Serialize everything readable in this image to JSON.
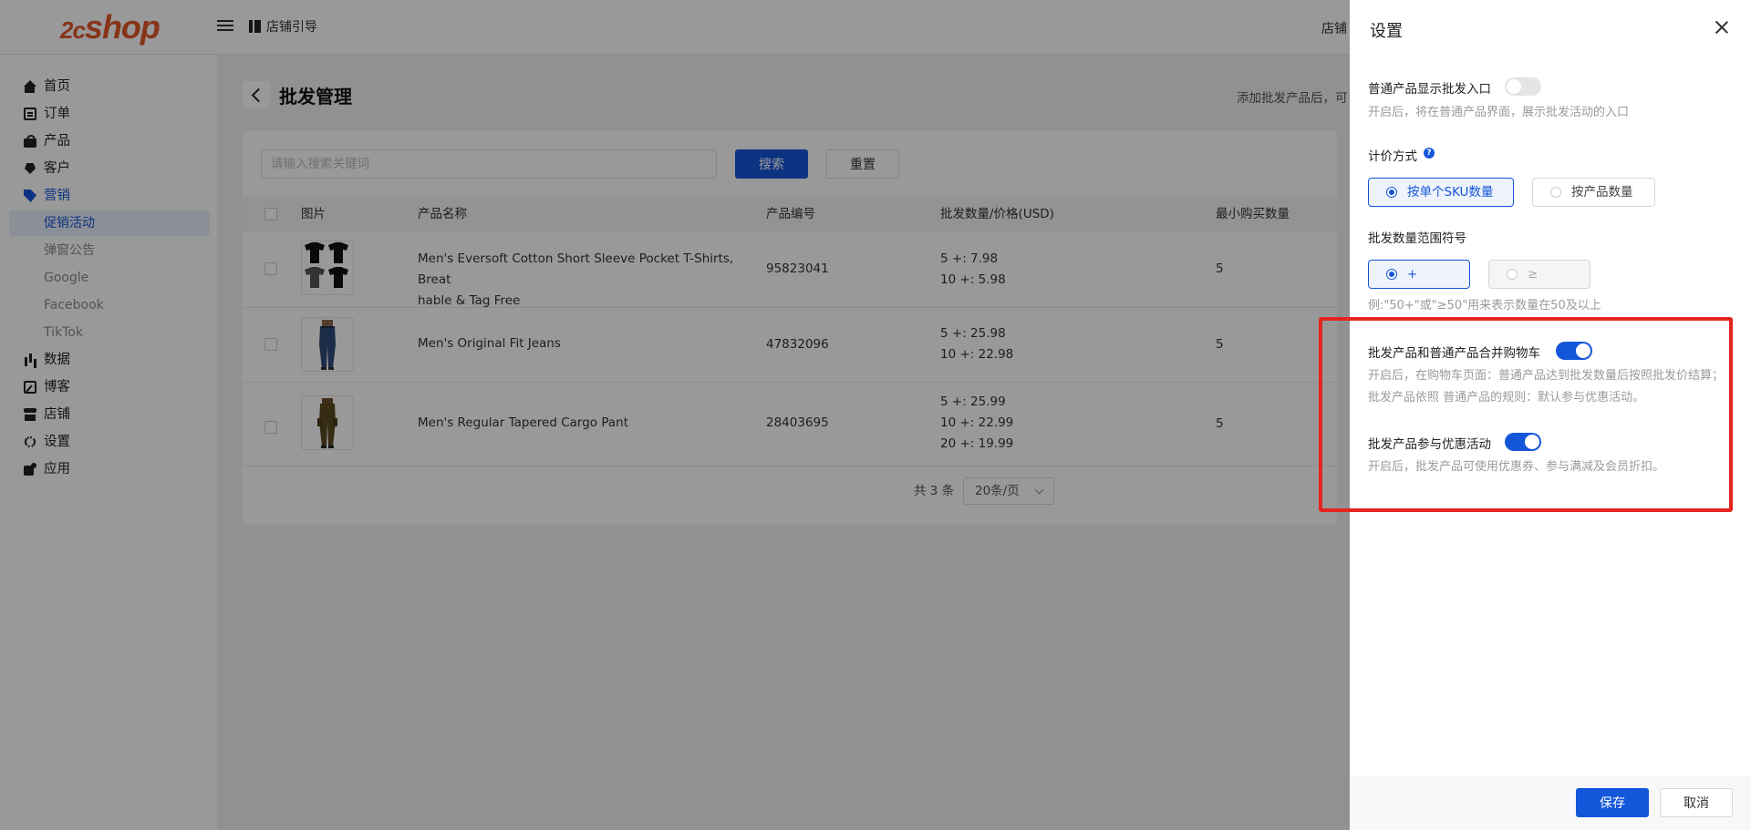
{
  "header": {
    "logo_prefix": "2c",
    "logo_text": "shop",
    "guide_label": "店铺引导",
    "right_label": "店铺"
  },
  "sidebar": {
    "items": [
      {
        "label": "首页",
        "icon": "home-icon"
      },
      {
        "label": "订单",
        "icon": "order-icon"
      },
      {
        "label": "产品",
        "icon": "bag-icon"
      },
      {
        "label": "客户",
        "icon": "diamond-icon"
      },
      {
        "label": "营销",
        "icon": "tag-icon"
      },
      {
        "label": "数据",
        "icon": "bar-chart-icon"
      },
      {
        "label": "博客",
        "icon": "edit-icon"
      },
      {
        "label": "店铺",
        "icon": "store-icon"
      },
      {
        "label": "设置",
        "icon": "gear-icon"
      },
      {
        "label": "应用",
        "icon": "puzzle-icon"
      }
    ],
    "sub_items": [
      {
        "label": "促销活动"
      },
      {
        "label": "弹窗公告"
      },
      {
        "label": "Google"
      },
      {
        "label": "Facebook"
      },
      {
        "label": "TikTok"
      }
    ]
  },
  "page": {
    "title": "批发管理",
    "hint": "添加批发产品后，可"
  },
  "search": {
    "placeholder": "请输入搜索关键词",
    "value": "",
    "search_label": "搜索",
    "reset_label": "重置"
  },
  "table": {
    "columns": [
      "图片",
      "产品名称",
      "产品编号",
      "批发数量/价格(USD)",
      "最小购买数量"
    ],
    "rows": [
      {
        "name_line1": "Men's Eversoft Cotton Short Sleeve Pocket T-Shirts, Breat",
        "name_line2": "hable & Tag Free",
        "sku": "95823041",
        "tiers": [
          "5 +: 7.98",
          "10 +: 5.98"
        ],
        "min_qty": "5"
      },
      {
        "name_line1": "Men's Original Fit Jeans",
        "name_line2": "",
        "sku": "47832096",
        "tiers": [
          "5 +: 25.98",
          "10 +: 22.98"
        ],
        "min_qty": "5"
      },
      {
        "name_line1": "Men's Regular Tapered Cargo Pant",
        "name_line2": "",
        "sku": "28403695",
        "tiers": [
          "5 +: 25.99",
          "10 +: 22.99",
          "20 +: 19.99"
        ],
        "min_qty": "5"
      }
    ]
  },
  "pager": {
    "total": "共 3 条",
    "page_size": "20条/页"
  },
  "drawer": {
    "title": "设置",
    "show_entry": {
      "label": "普通产品显示批发入口",
      "enabled": false,
      "desc": "开启后，将在普通产品界面，展示批发活动的入口"
    },
    "pricing": {
      "label": "计价方式",
      "help": "?",
      "options": [
        "按单个SKU数量",
        "按产品数量"
      ],
      "selected": "按单个SKU数量"
    },
    "symbol": {
      "label": "批发数量范围符号",
      "options": [
        "+",
        "≥"
      ],
      "selected": "+",
      "desc": "例:\"50+\"或\"≥50\"用来表示数量在50及以上"
    },
    "merge_cart": {
      "label": "批发产品和普通产品合并购物车",
      "enabled": true,
      "desc_line1": "开启后，在购物车页面：普通产品达到批发数量后按照批发价结算；",
      "desc_line2": "批发产品依照 普通产品的规则：默认参与优惠活动。"
    },
    "promo": {
      "label": "批发产品参与优惠活动",
      "enabled": true,
      "desc": "开启后，批发产品可使用优惠券、参与满减及会员折扣。"
    },
    "save_label": "保存",
    "cancel_label": "取消"
  },
  "colors": {
    "primary": "#1456d9",
    "logo": "#e2572a",
    "highlight": "#e52420"
  }
}
